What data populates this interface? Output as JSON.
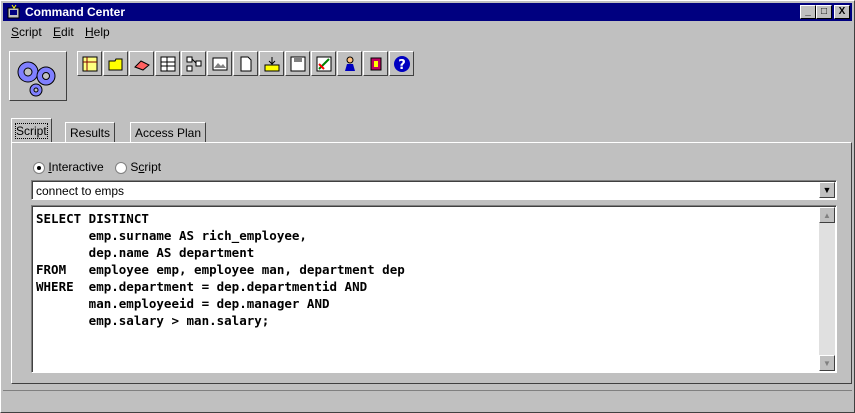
{
  "window": {
    "title": "Command Center",
    "controls": [
      "_",
      "□",
      "X"
    ]
  },
  "menu": {
    "items": [
      {
        "label": "Script",
        "mnemonic": "S",
        "rest": "cript"
      },
      {
        "label": "Edit",
        "mnemonic": "E",
        "rest": "dit"
      },
      {
        "label": "Help",
        "mnemonic": "H",
        "rest": "elp"
      }
    ]
  },
  "toolbar": {
    "icons": [
      "execute-gears-icon",
      "table-icon",
      "open-folder-icon",
      "eraser-icon",
      "grid-icon",
      "tree-icon",
      "image-icon",
      "new-document-icon",
      "import-icon",
      "save-icon",
      "edit-chart-icon",
      "users-icon",
      "reload-icon",
      "help-icon"
    ]
  },
  "tabs": [
    {
      "label": "Script",
      "active": true
    },
    {
      "label": "Results",
      "active": false
    },
    {
      "label": "Access Plan",
      "active": false
    }
  ],
  "mode": {
    "interactive": {
      "label": "Interactive",
      "mnemonic": "I",
      "rest": "nteractive",
      "selected": true
    },
    "script": {
      "label": "Script",
      "pre": "S",
      "mnemonic": "c",
      "rest": "ript",
      "selected": false
    }
  },
  "connection": {
    "value": "connect to emps"
  },
  "editor": {
    "text": "SELECT DISTINCT\n       emp.surname AS rich_employee,\n       dep.name AS department\nFROM   employee emp, employee man, department dep\nWHERE  emp.department = dep.departmentid AND\n       man.employeeid = dep.manager AND\n       emp.salary > man.salary;"
  },
  "colors": {
    "titlebar": "#000080",
    "face": "#c0c0c0"
  }
}
